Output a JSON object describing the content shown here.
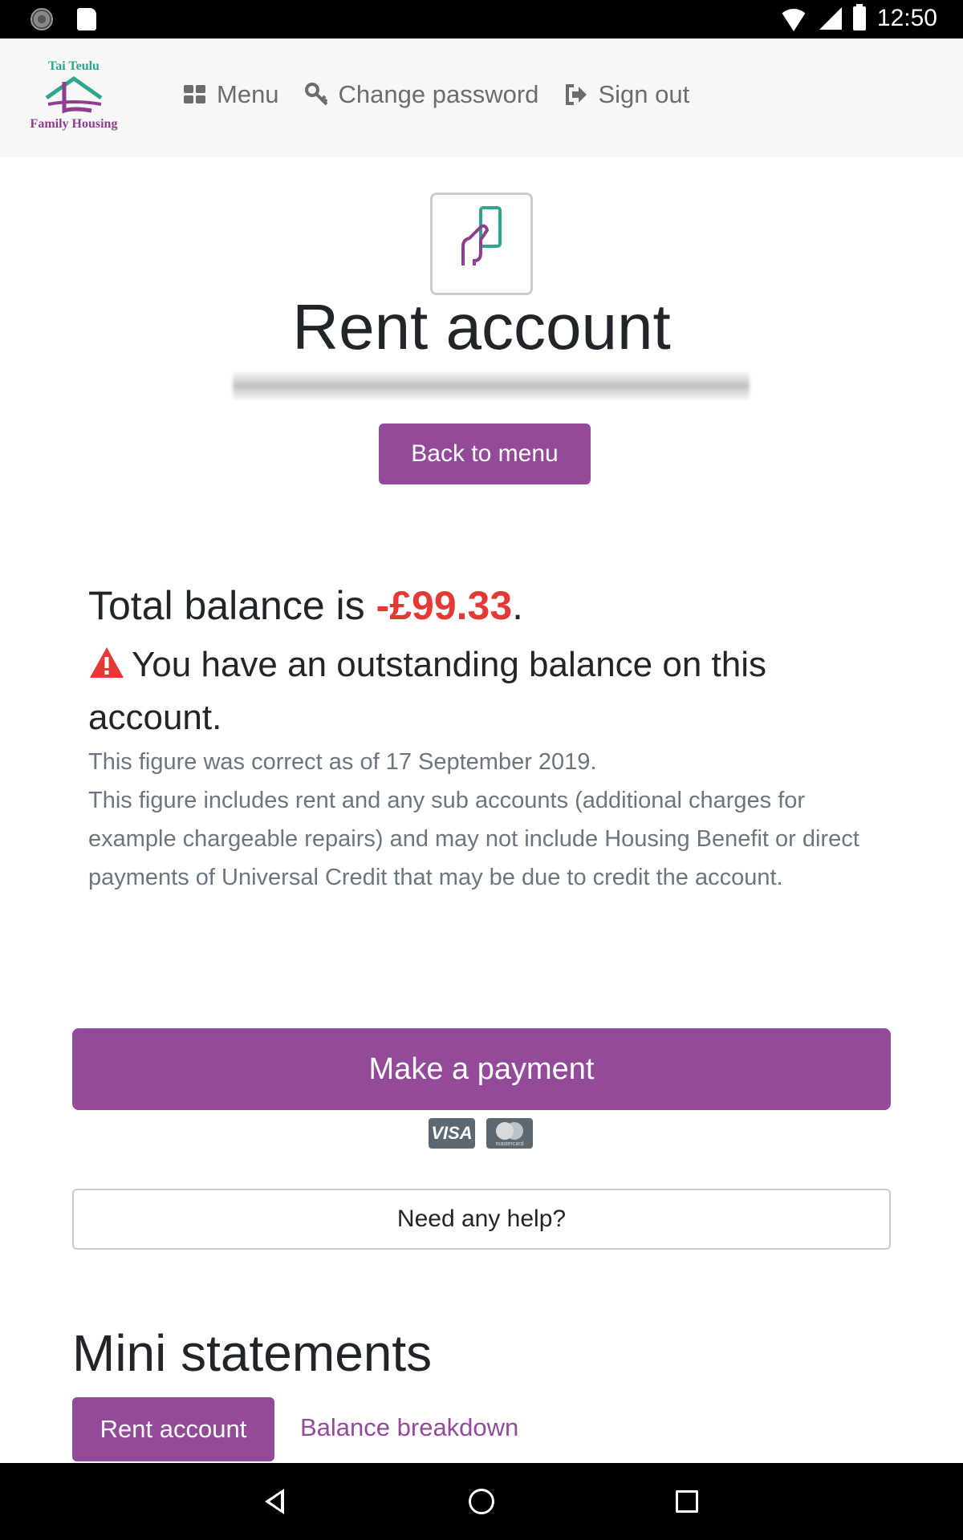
{
  "status_bar": {
    "time": "12:50"
  },
  "header": {
    "logo_top": "Tai Teulu",
    "logo_bottom": "Family Housing",
    "nav": [
      {
        "label": "Menu",
        "icon": "grid-icon"
      },
      {
        "label": "Change password",
        "icon": "key-icon"
      },
      {
        "label": "Sign out",
        "icon": "sign-out-icon"
      }
    ]
  },
  "main": {
    "title": "Rent account",
    "back_button": "Back to menu",
    "balance_prefix": "Total balance is ",
    "balance_amount": "-£99.33",
    "balance_suffix": ".",
    "warning": "You have an outstanding balance on this account.",
    "date_note": "This figure was correct as of 17 September 2019.",
    "includes_note": "This figure includes rent and any sub accounts (additional charges for example chargeable repairs) and may not include Housing Benefit or direct payments of Universal Credit that may be due to credit the account.",
    "pay_button": "Make a payment",
    "visa_label": "VISA",
    "mastercard_label": "mastercard",
    "help_button": "Need any help?"
  },
  "mini_statements": {
    "title": "Mini statements",
    "tabs": [
      "Rent account",
      "Balance breakdown"
    ]
  },
  "colors": {
    "brand": "#934a99",
    "negative": "#e53935",
    "logo_green": "#2fa58d"
  }
}
